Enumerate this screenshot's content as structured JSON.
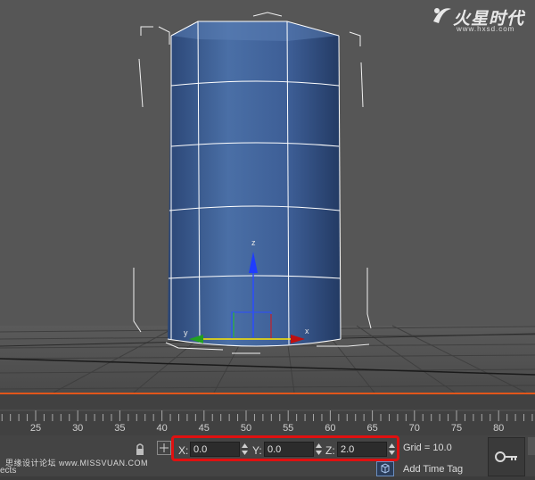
{
  "viewport": {
    "gizmo": {
      "z_label": "z",
      "y_label": "y",
      "x_label": "x"
    }
  },
  "logo": {
    "text": "火星时代",
    "url": "www.hxsd.com"
  },
  "timeline": {
    "ticks": [
      "25",
      "30",
      "35",
      "40",
      "45",
      "50",
      "55",
      "60",
      "65",
      "70",
      "75",
      "80"
    ]
  },
  "status_bar": {
    "coords": {
      "x_label": "X:",
      "x_value": "0.0",
      "y_label": "Y:",
      "y_value": "0.0",
      "z_label": "Z:",
      "z_value": "2.0"
    },
    "grid_label": "Grid = 10.0",
    "add_time_tag_label": "Add Time Tag",
    "watermark": "思缘设计论坛 www.MISSVUAN.COM",
    "partial_text": "ects"
  },
  "colors": {
    "accent": "#e2561a",
    "highlight_box": "#e01010",
    "cylinder": "#3d5e96"
  }
}
